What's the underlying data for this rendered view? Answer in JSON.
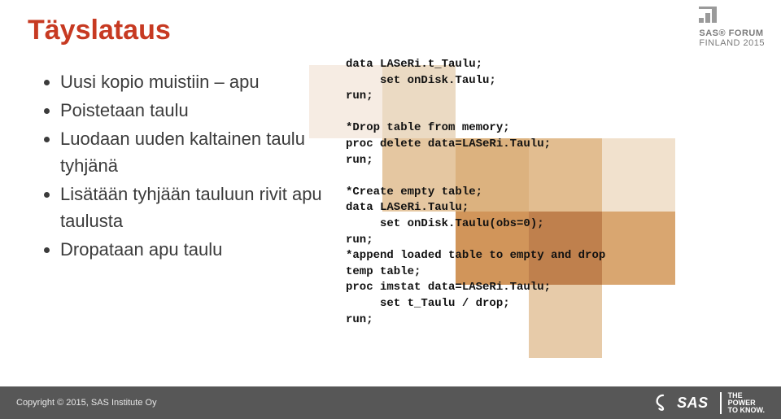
{
  "title": "Täyslataus",
  "bullets": [
    "Uusi kopio muistiin – apu",
    "Poistetaan taulu",
    "Luodaan uuden kaltainen taulu tyhjänä",
    "Lisätään tyhjään tauluun rivit apu taulusta",
    "Dropataan apu taulu"
  ],
  "code": "data LASeRi.t_Taulu;\n     set onDisk.Taulu;\nrun;\n\n*Drop table from memory;\nproc delete data=LASeRi.Taulu;\nrun;\n\n*Create empty table;\ndata LASeRi.Taulu;\n     set onDisk.Taulu(obs=0);\nrun;\n*append loaded table to empty and drop\ntemp table;\nproc imstat data=LASeRi.Taulu;\n     set t_Taulu / drop;\nrun;",
  "forum": {
    "line1": "SAS® FORUM",
    "line2": "FINLAND 2015"
  },
  "footer": {
    "copyright": "Copyright © 2015, SAS Institute Oy",
    "sas": "SAS",
    "tagline": "THE\nPOWER\nTO KNOW."
  },
  "colors": {
    "c1": "#f4e9de",
    "c2": "#e4c9a7",
    "c3": "#d9a96f",
    "c4": "#c9823d",
    "c5": "#a95a28"
  }
}
